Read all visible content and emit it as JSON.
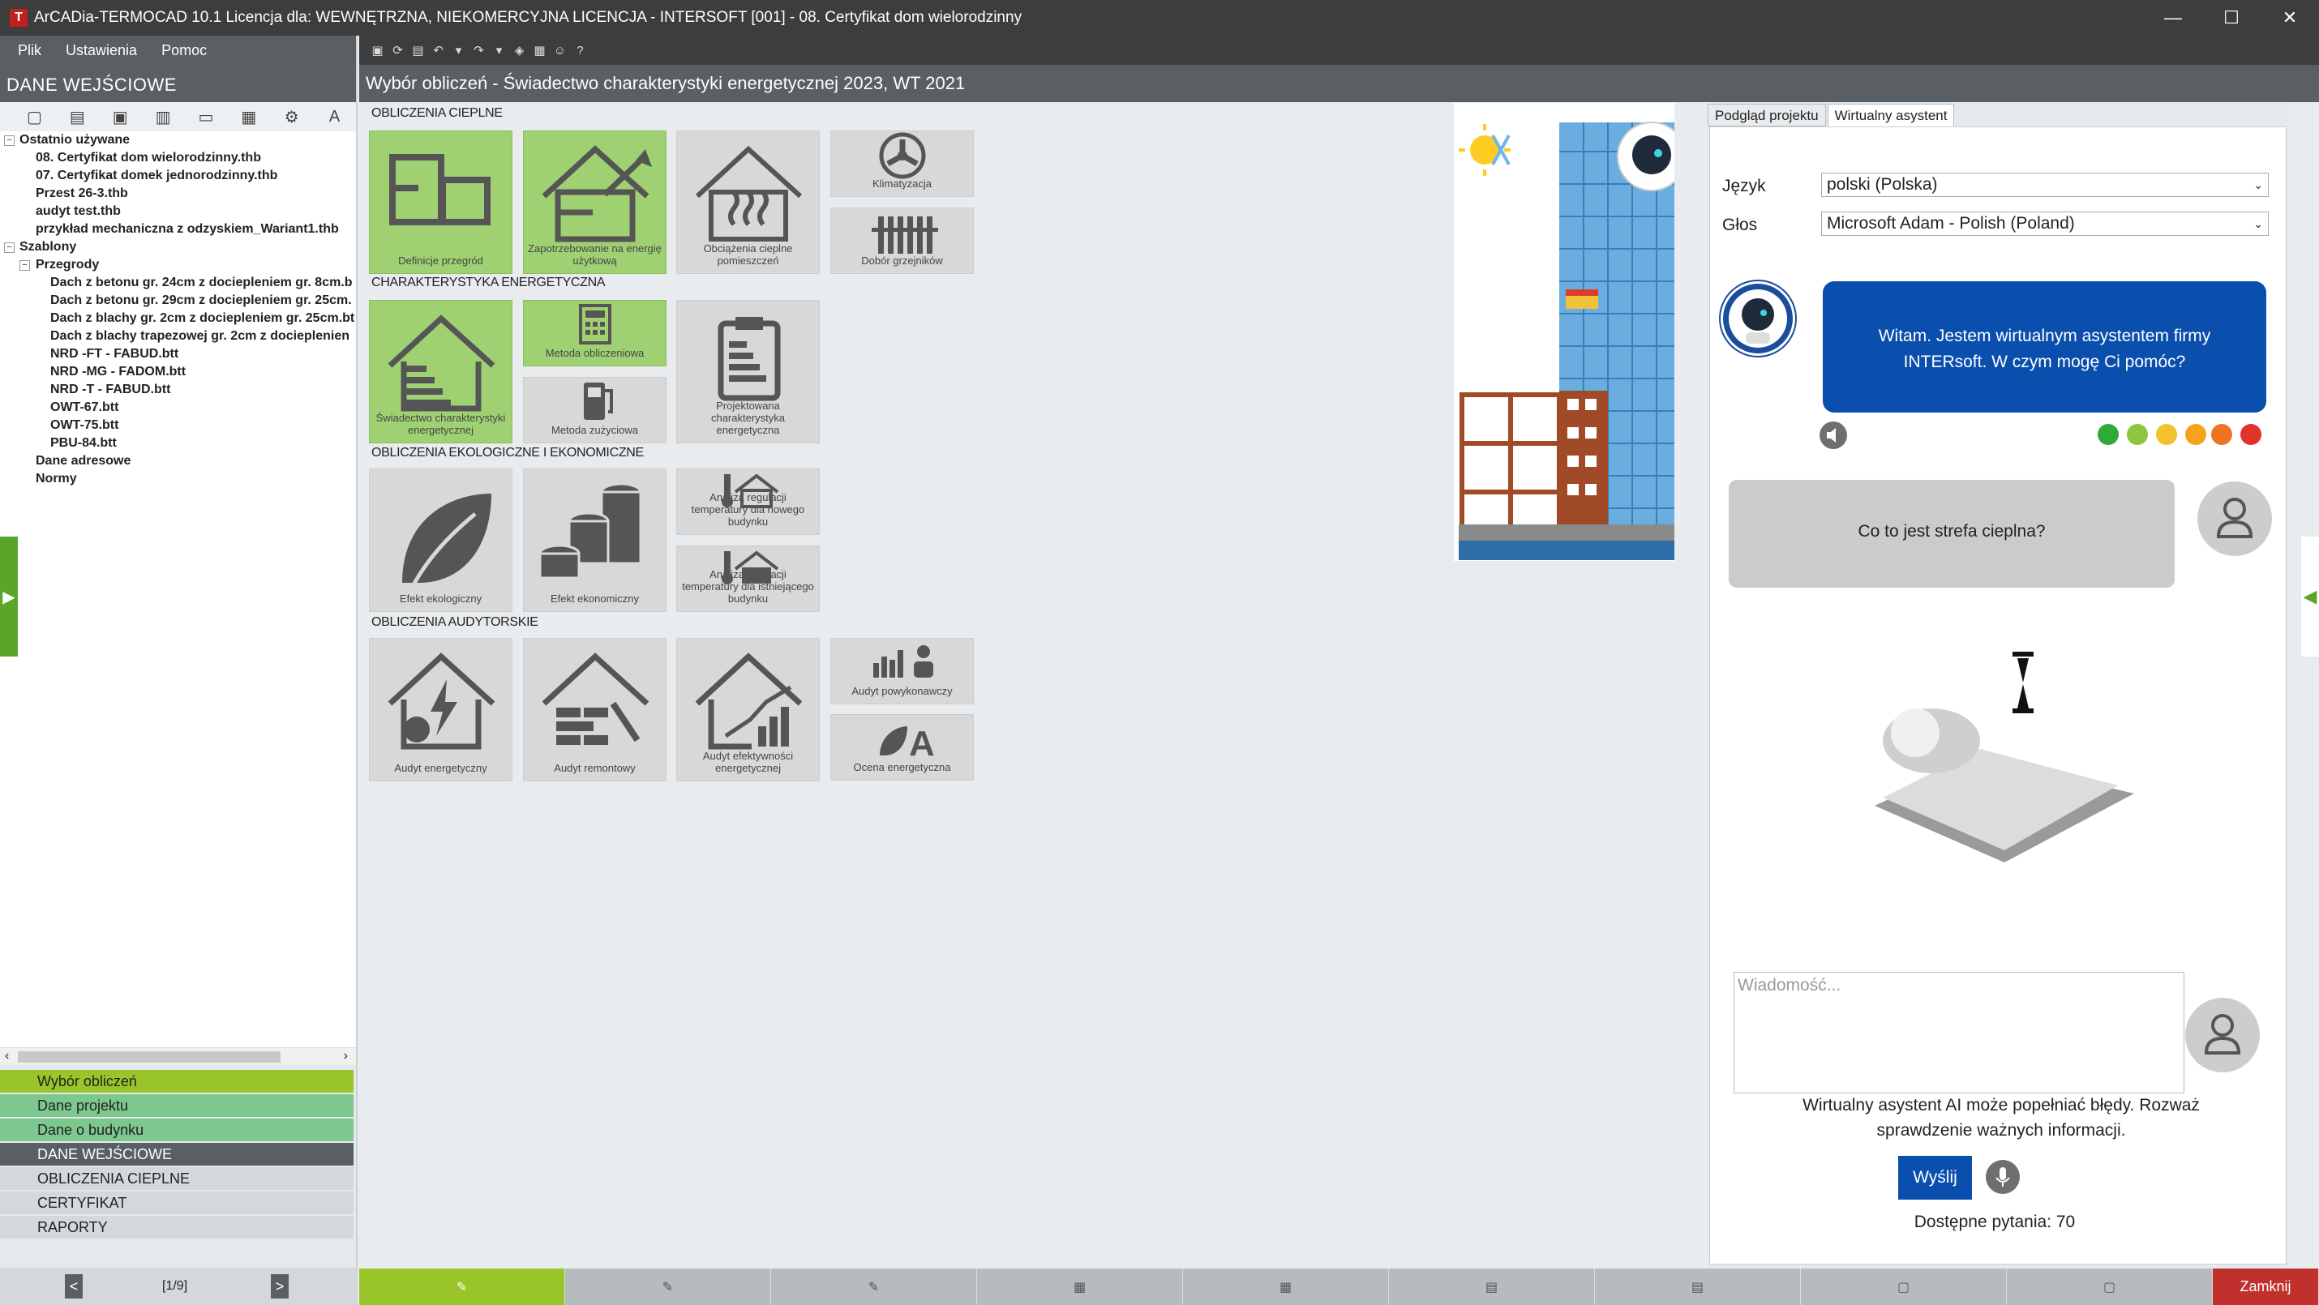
{
  "window": {
    "title": "ArCADia-TERMOCAD 10.1 Licencja dla: WEWNĘTRZNA, NIEKOMERCYJNA LICENCJA - INTERSOFT [001] - 08. Certyfikat dom wielorodzinny",
    "minimize": "—",
    "maximize": "☐",
    "close": "✕"
  },
  "menu": {
    "file": "Plik",
    "settings": "Ustawienia",
    "help": "Pomoc"
  },
  "left": {
    "header": "DANE WEJŚCIOWE",
    "tree": {
      "recent_label": "Ostatnio używane",
      "recent": [
        "08. Certyfikat dom wielorodzinny.thb",
        "07. Certyfikat domek jednorodzinny.thb",
        "Przest 26-3.thb",
        "audyt test.thb",
        "przykład mechaniczna z odzyskiem_Wariant1.thb"
      ],
      "templates_label": "Szablony",
      "partitions_label": "Przegrody",
      "partitions": [
        "Dach z betonu gr. 24cm z dociepleniem gr. 8cm.b",
        "Dach z betonu gr. 29cm z dociepleniem gr. 25cm.",
        "Dach z blachy gr. 2cm z dociepleniem gr. 25cm.bt",
        "Dach z blachy trapezowej gr. 2cm z docieplenien",
        "NRD -FT - FABUD.btt",
        "NRD -MG - FADOM.btt",
        "NRD -T - FABUD.btt",
        "OWT-67.btt",
        "OWT-75.btt",
        "PBU-84.btt"
      ],
      "address_label": "Dane adresowe",
      "norms_label": "Normy"
    },
    "nav": [
      "Wybór obliczeń",
      "Dane projektu",
      "Dane o budynku",
      "DANE WEJŚCIOWE",
      "OBLICZENIA CIEPLNE",
      "CERTYFIKAT",
      "RAPORTY"
    ],
    "pager": {
      "prev": "<",
      "next": ">",
      "text": "[1/9]"
    }
  },
  "main": {
    "title": "Wybór obliczeń - Świadectwo charakterystyki energetycznej 2023, WT 2021",
    "sections": {
      "thermal": "OBLICZENIA CIEPLNE",
      "energy": "CHARAKTERYSTYKA ENERGETYCZNA",
      "eco": "OBLICZENIA EKOLOGICZNE I EKONOMICZNE",
      "audit": "OBLICZENIA AUDYTORSKIE"
    },
    "tiles": {
      "partitions": "Definicje przegród",
      "demand": "Zapotrzebowanie na energię użytkową",
      "heatloads": "Obciążenia cieplne pomieszczeń",
      "ac": "Klimatyzacja",
      "radiators": "Dobór grzejników",
      "certificate": "Świadectwo charakterystyki energetycznej",
      "calcmethod": "Metoda obliczeniowa",
      "consmethod": "Metoda zużyciowa",
      "designed": "Projektowana charakterystyka energetyczna",
      "ecoeffect": "Efekt ekologiczny",
      "economic": "Efekt ekonomiczny",
      "tempnew": "Analiza regulacji temperatury dla nowego budynku",
      "tempexisting": "Analiza regulacji temperatury dla istniejącego budynku",
      "energyaudit": "Audyt energetyczny",
      "renovaudit": "Audyt remontowy",
      "efficiencyaudit": "Audyt efektywności energetycznej",
      "postaudit": "Audyt powykonawczy",
      "energyrating": "Ocena energetyczna"
    }
  },
  "right": {
    "tabs": [
      "Podgląd projektu",
      "Wirtualny asystent"
    ],
    "language_label": "Język",
    "language_value": "polski (Polska)",
    "voice_label": "Głos",
    "voice_value": "Microsoft Adam - Polish (Poland)",
    "bot_message": "Witam. Jestem wirtualnym asystentem firmy INTERsoft. W czym mogę Ci pomóc?",
    "user_message": "Co to jest strefa cieplna?",
    "message_placeholder": "Wiadomość...",
    "disclaimer": "Wirtualny asystent AI może popełniać błędy. Rozważ sprawdzenie ważnych informacji.",
    "send": "Wyślij",
    "available": "Dostępne pytania: 70",
    "rating_colors": [
      "#2faa3a",
      "#8cc63f",
      "#f2c12e",
      "#f7a21b",
      "#ef7422",
      "#e0332a"
    ]
  },
  "bottom": {
    "close": "Zamknij"
  }
}
